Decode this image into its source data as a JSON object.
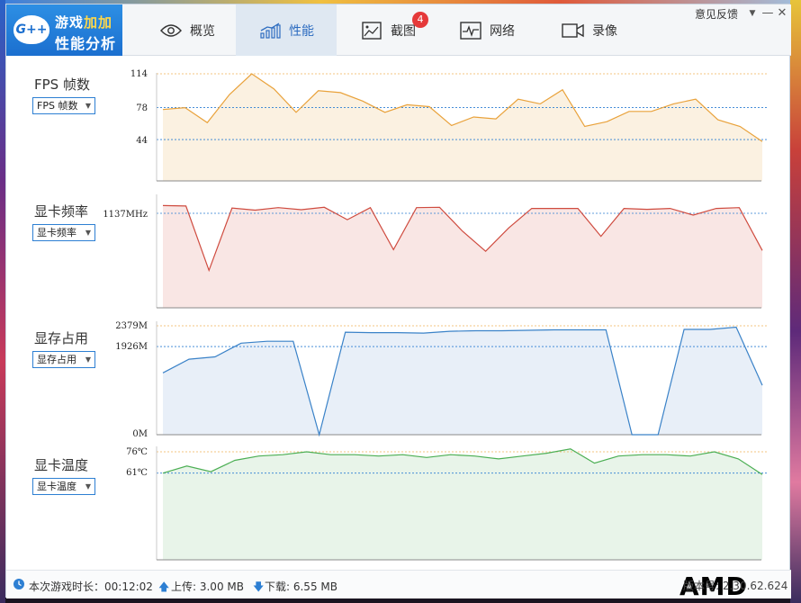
{
  "header": {
    "logo_badge": "G++",
    "logo_line1_a": "游戏",
    "logo_line1_b": "加加",
    "logo_line2": "性能分析",
    "tabs": [
      {
        "label": "概览",
        "icon": "eye-icon",
        "active": false
      },
      {
        "label": "性能",
        "icon": "performance-chart-icon",
        "active": true
      },
      {
        "label": "截图",
        "icon": "screenshot-icon",
        "active": false,
        "badge": "4"
      },
      {
        "label": "网络",
        "icon": "network-pulse-icon",
        "active": false
      },
      {
        "label": "录像",
        "icon": "video-camera-icon",
        "active": false
      }
    ],
    "feedback": "意见反馈",
    "dropdown_glyph": "▼",
    "minimize_glyph": "—",
    "close_glyph": "✕"
  },
  "panels": [
    {
      "label": "FPS 帧数",
      "select": "FPS 帧数",
      "ticks": [
        "114",
        "78",
        "44"
      ]
    },
    {
      "label": "显卡频率",
      "select": "显卡频率",
      "ticks": [
        "1137MHz"
      ]
    },
    {
      "label": "显存占用",
      "select": "显存占用",
      "ticks": [
        "2379M",
        "1926M",
        "0M"
      ]
    },
    {
      "label": "显卡温度",
      "select": "显卡温度",
      "ticks": [
        "76℃",
        "61℃"
      ]
    }
  ],
  "chart_data": [
    {
      "type": "area",
      "ylabel": "FPS 帧数",
      "color": "#e9a23b",
      "fill": "#fbf1e1",
      "ref_lines": [
        114,
        78,
        44
      ],
      "ylim": [
        0,
        114
      ],
      "values": [
        76,
        78,
        62,
        92,
        114,
        98,
        73,
        96,
        94,
        85,
        73,
        81,
        79,
        59,
        68,
        66,
        87,
        82,
        97,
        58,
        63,
        74,
        74,
        82,
        87,
        65,
        58,
        42
      ]
    },
    {
      "type": "area",
      "ylabel": "显卡频率",
      "color": "#cf4b3f",
      "fill": "#f9e6e4",
      "ref_lines": [
        1137
      ],
      "ylim": [
        0,
        1137
      ],
      "values": [
        1230,
        1225,
        450,
        1200,
        1175,
        1205,
        1180,
        1210,
        1060,
        1205,
        700,
        1205,
        1210,
        920,
        680,
        960,
        1195,
        1195,
        1195,
        860,
        1195,
        1185,
        1195,
        1115,
        1195,
        1205,
        690
      ]
    },
    {
      "type": "area",
      "ylabel": "显存占用",
      "color": "#3a82c8",
      "fill": "#e8eff8",
      "ref_lines": [
        2379,
        1926,
        0
      ],
      "ylim": [
        0,
        2379
      ],
      "values": [
        1350,
        1650,
        1700,
        2000,
        2040,
        2040,
        0,
        2240,
        2230,
        2230,
        2220,
        2260,
        2270,
        2270,
        2280,
        2290,
        2290,
        2290,
        0,
        0,
        2300,
        2300,
        2350,
        1080
      ]
    },
    {
      "type": "area",
      "ylabel": "显卡温度",
      "color": "#4caf54",
      "fill": "#e8f4e9",
      "ref_lines": [
        76,
        61
      ],
      "ylim": [
        0,
        76
      ],
      "values": [
        61,
        66,
        62,
        70,
        73,
        74,
        76,
        74,
        74,
        73,
        74,
        72,
        74,
        73,
        71,
        73,
        75,
        78,
        68,
        73,
        74,
        74,
        73,
        76,
        71,
        60
      ]
    }
  ],
  "status": {
    "duration_label": "本次游戏时长：00:12:02",
    "upload_label": "上传: 3.00 MB",
    "download_label": "下载: 6.55 MB",
    "brand": "AMD",
    "version": "版本号: 2.30.62.624"
  }
}
